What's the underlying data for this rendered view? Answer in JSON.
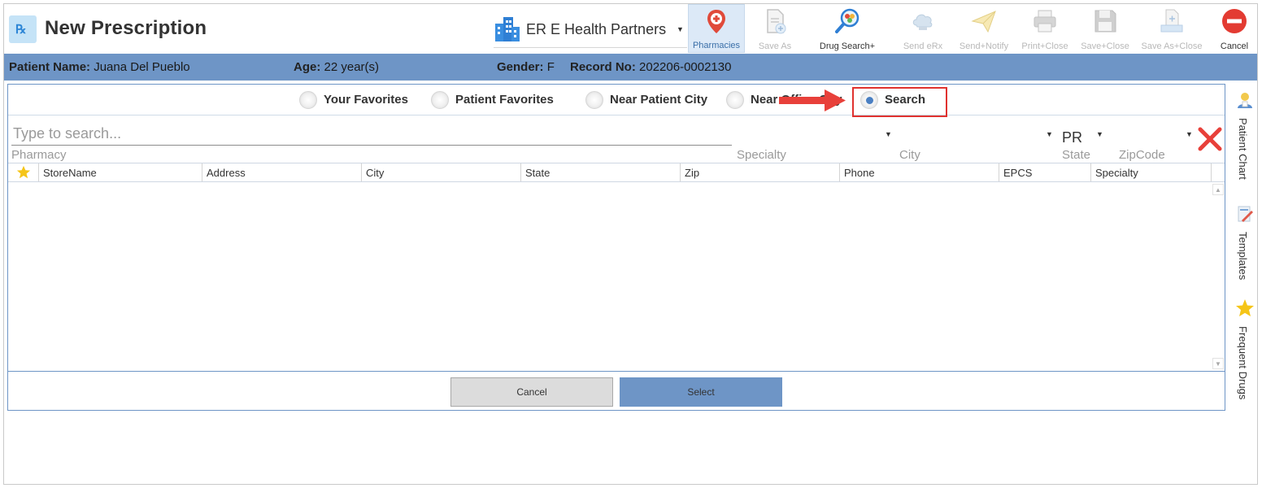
{
  "header": {
    "title": "New Prescription",
    "organization": "ER E Health Partners"
  },
  "toolbar": {
    "buttons": [
      {
        "label": "Pharmacies",
        "icon": "pharmacy-pin-icon",
        "state": "active"
      },
      {
        "label": "Save As",
        "icon": "save-as-document-icon",
        "state": "disabled"
      },
      {
        "label": "Drug Search+",
        "icon": "drug-search-icon",
        "state": "enabled"
      },
      {
        "label": "Send eRx",
        "icon": "send-erx-cloud-icon",
        "state": "disabled"
      },
      {
        "label": "Send+Notify",
        "icon": "paper-plane-icon",
        "state": "disabled"
      },
      {
        "label": "Print+Close",
        "icon": "printer-icon",
        "state": "disabled"
      },
      {
        "label": "Save+Close",
        "icon": "floppy-disk-icon",
        "state": "disabled"
      },
      {
        "label": "Save As+Close",
        "icon": "save-as-close-icon",
        "state": "disabled"
      },
      {
        "label": "Cancel",
        "icon": "cancel-stop-icon",
        "state": "enabled"
      }
    ]
  },
  "patient": {
    "name_label": "Patient Name:",
    "name": "Juana Del Pueblo",
    "age_label": "Age:",
    "age": "22 year(s)",
    "gender_label": "Gender:",
    "gender": "F",
    "record_label": "Record No:",
    "record": "202206-0002130"
  },
  "search_mode": {
    "options": [
      "Your Favorites",
      "Patient Favorites",
      "Near Patient City",
      "Near Office City",
      "Search"
    ],
    "selected": "Search"
  },
  "filters": {
    "pharmacy_placeholder": "Type to search...",
    "pharmacy_label": "Pharmacy",
    "specialty_label": "Specialty",
    "city_label": "City",
    "state_label": "State",
    "state_value": "PR",
    "zipcode_label": "ZipCode"
  },
  "grid": {
    "columns": [
      "StoreName",
      "Address",
      "City",
      "State",
      "Zip",
      "Phone",
      "EPCS",
      "Specialty"
    ],
    "rows": []
  },
  "actions": {
    "cancel": "Cancel",
    "select": "Select"
  },
  "side_panel": {
    "items": [
      "Patient Chart",
      "Templates",
      "Frequent Drugs"
    ]
  },
  "colors": {
    "accent": "#6e95c6",
    "highlight": "#e0322f"
  }
}
